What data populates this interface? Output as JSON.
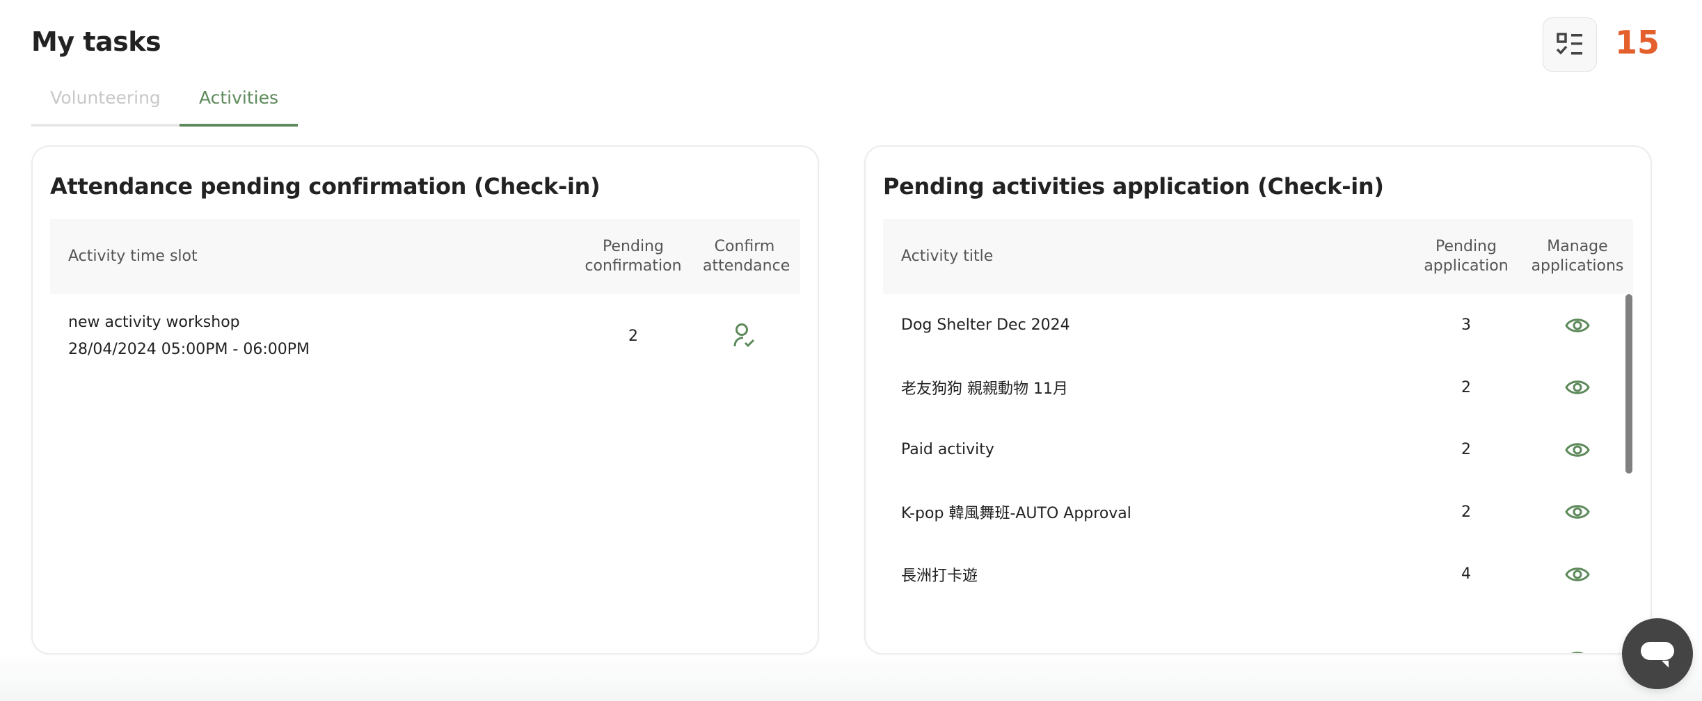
{
  "header": {
    "title": "My tasks",
    "task_icon": "checklist-icon",
    "task_count": "15"
  },
  "tabs": [
    {
      "label": "Volunteering",
      "active": false
    },
    {
      "label": "Activities",
      "active": true
    }
  ],
  "colors": {
    "accent": "#5e8a5b",
    "count": "#e35f2c",
    "scrollbar": "#808080",
    "chat_button": "#444444"
  },
  "attendance": {
    "title": "Attendance pending confirmation (Check-in)",
    "columns": [
      "Activity time slot",
      "Pending confirmation",
      "Confirm attendance"
    ],
    "rows": [
      {
        "activity": "new activity workshop",
        "time_slot": "28/04/2024 05:00PM - 06:00PM",
        "pending": "2",
        "action_icon": "user-check-icon"
      }
    ]
  },
  "applications": {
    "title": "Pending activities application (Check-in)",
    "columns": [
      "Activity title",
      "Pending application",
      "Manage applications"
    ],
    "rows": [
      {
        "title": "Dog Shelter Dec 2024",
        "pending": "3",
        "action_icon": "eye-icon"
      },
      {
        "title": "老友狗狗 親親動物 11月",
        "pending": "2",
        "action_icon": "eye-icon"
      },
      {
        "title": "Paid activity",
        "pending": "2",
        "action_icon": "eye-icon"
      },
      {
        "title": "K-pop 韓風舞班-AUTO Approval",
        "pending": "2",
        "action_icon": "eye-icon"
      },
      {
        "title": "長洲打卡遊",
        "pending": "4",
        "action_icon": "eye-icon"
      }
    ]
  },
  "chat": {
    "icon": "chat-bubble-icon"
  }
}
